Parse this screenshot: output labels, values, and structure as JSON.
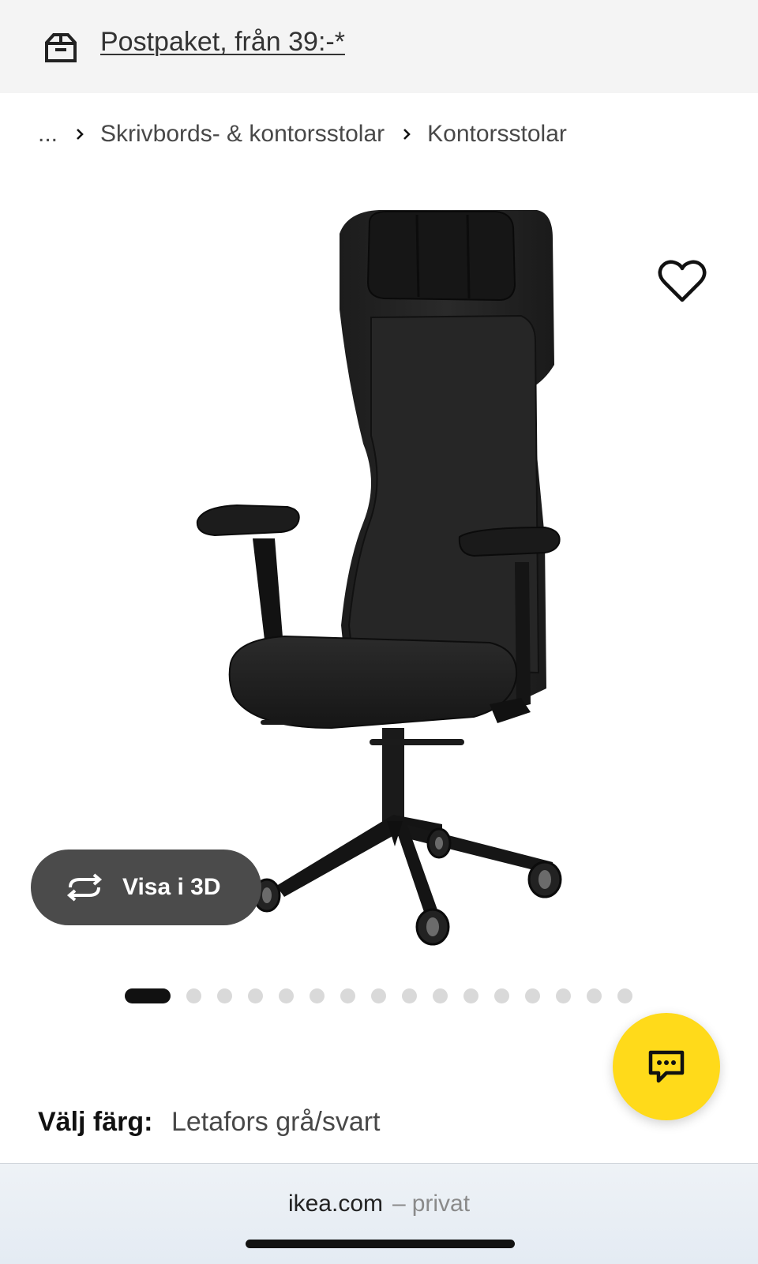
{
  "banner": {
    "icon": "package-box-icon",
    "text": "Postpaket, från 39:-*"
  },
  "breadcrumb": {
    "items": [
      "...",
      "Skrivbords- & kontorsstolar",
      "Kontorsstolar"
    ],
    "separator_icon": "chevron-right-icon"
  },
  "product": {
    "image_icon": "office-chair-image",
    "favorite_icon": "heart-outline-icon",
    "view_3d": {
      "icon": "rotate-3d-icon",
      "label": "Visa i 3D"
    },
    "gallery": {
      "total_images": 17,
      "active_index": 0
    }
  },
  "chat": {
    "icon": "chat-bubble-icon",
    "accent": "#ffda1a"
  },
  "color_select": {
    "label": "Välj färg:",
    "value": "Letafors grå/svart"
  },
  "browser": {
    "domain": "ikea.com",
    "dash": "–",
    "mode": "privat"
  }
}
